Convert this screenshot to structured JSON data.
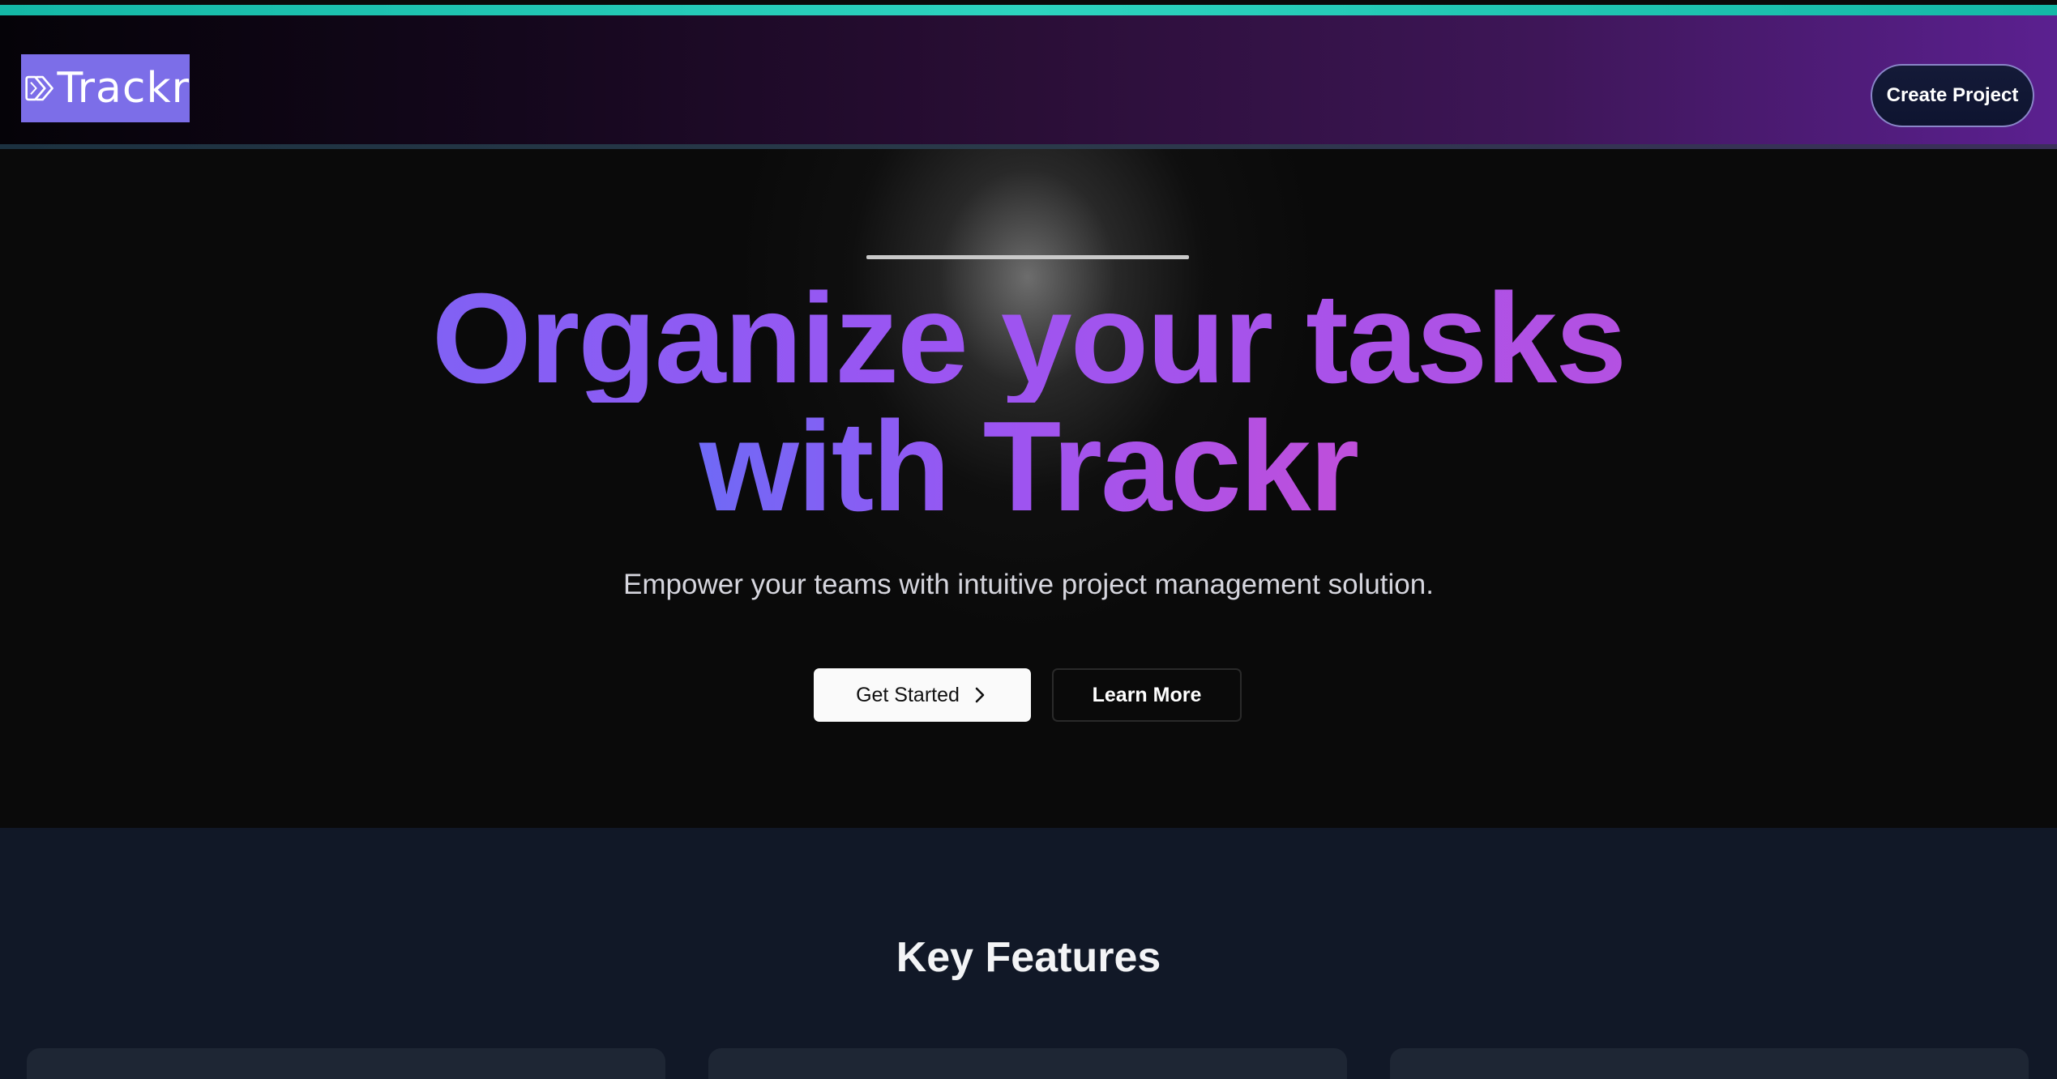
{
  "header": {
    "logo_text": "Trackr",
    "create_button_label": "Create Project"
  },
  "hero": {
    "title_line1_part1": "Organize",
    "title_line1_part2": "your",
    "title_line1_part3": "tasks",
    "title_line2": "with Trackr",
    "subtitle": "Empower your teams with intuitive project management solution.",
    "primary_button_label": "Get Started",
    "secondary_button_label": "Learn More"
  },
  "features": {
    "title": "Key Features"
  },
  "icons": {
    "logo": "double-chevron-logo-icon",
    "get_started": "chevron-right-icon"
  },
  "colors": {
    "accent_line": "#14b8a6",
    "gradient_start": "#6a6cf6",
    "gradient_mid": "#9b55f2",
    "gradient_end": "#c34ed8",
    "logo_bg": "#7c6ee8",
    "features_bg": "#111827"
  }
}
